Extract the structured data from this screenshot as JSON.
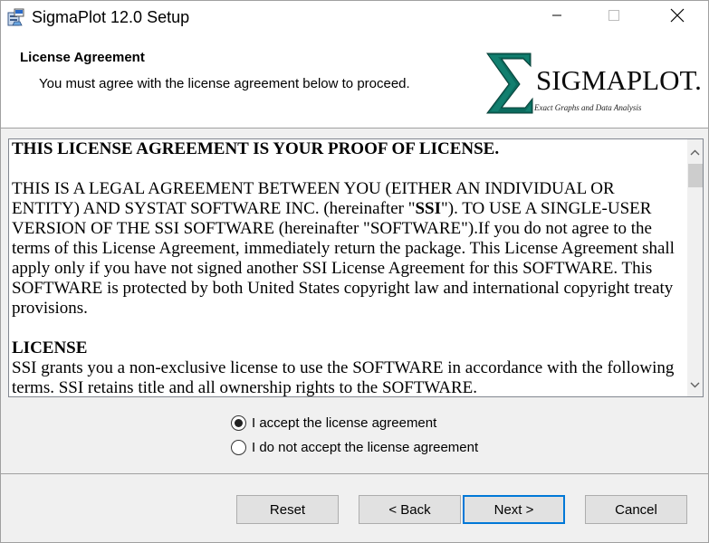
{
  "window": {
    "title": "SigmaPlot 12.0 Setup"
  },
  "header": {
    "title": "License Agreement",
    "subtitle": "You must agree with the license agreement below to proceed.",
    "logo_wordmark": "SIGMAPLOT.",
    "logo_tagline": "Exact Graphs and Data Analysis"
  },
  "license": {
    "heading": "THIS LICENSE AGREEMENT IS YOUR PROOF OF LICENSE.",
    "para1_part1": "THIS IS A LEGAL AGREEMENT BETWEEN YOU (EITHER AN INDIVIDUAL OR ENTITY) AND SYSTAT SOFTWARE INC. (hereinafter \"",
    "para1_bold": "SSI",
    "para1_part2": "\"). TO USE A SINGLE-USER VERSION OF THE SSI SOFTWARE (hereinafter \"SOFTWARE\").If you do not agree to the terms of this License Agreement, immediately return the package. This License Agreement shall apply only if you have not signed another SSI License Agreement for this SOFTWARE. This SOFTWARE is protected by both United States copyright law and international copyright treaty provisions.",
    "section_heading": "LICENSE",
    "para2": "SSI grants you a non-exclusive license to use the SOFTWARE in accordance with the following terms. SSI retains title and all ownership rights to the SOFTWARE."
  },
  "options": {
    "accept": "I accept the license agreement",
    "decline": "I do not accept the license agreement",
    "selected": "accept"
  },
  "buttons": {
    "reset": "Reset",
    "back": "< Back",
    "next": "Next >",
    "cancel": "Cancel"
  }
}
